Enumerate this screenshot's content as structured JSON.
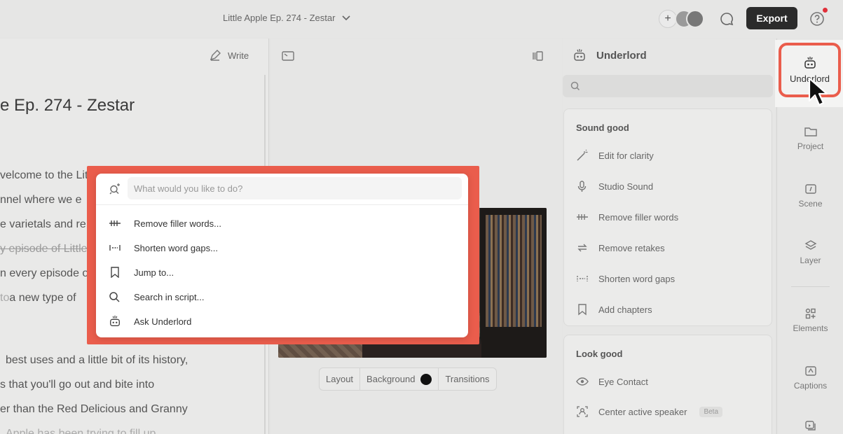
{
  "topbar": {
    "doc_title": "Little Apple Ep. 274 - Zestar",
    "plus_label": "+",
    "export_label": "Export"
  },
  "script": {
    "write_label": "Write",
    "title": "e Ep. 274 - Zestar",
    "paragraphs": [
      "velcome to the Little Apple",
      "nnel where we e",
      "e varietals and re",
      "y episode of Little",
      "n every episode of",
      "to",
      "a new type of",
      "best uses and a little bit of its history,",
      "s that you'll go out and bite into",
      "er than the Red Delicious and Granny",
      "Apple has been trying to fill up"
    ]
  },
  "video_toolbar": {
    "layout": "Layout",
    "background": "Background",
    "transitions": "Transitions"
  },
  "underlord": {
    "title": "Underlord",
    "sections": [
      {
        "title": "Sound good",
        "items": [
          {
            "label": "Edit for clarity",
            "icon": "wand-icon"
          },
          {
            "label": "Studio Sound",
            "icon": "microphone-sparkle-icon"
          },
          {
            "label": "Remove filler words",
            "icon": "filler-words-icon"
          },
          {
            "label": "Remove retakes",
            "icon": "retake-icon"
          },
          {
            "label": "Shorten word gaps",
            "icon": "word-gap-icon"
          },
          {
            "label": "Add chapters",
            "icon": "bookmark-icon"
          }
        ]
      },
      {
        "title": "Look good",
        "items": [
          {
            "label": "Eye Contact",
            "icon": "eye-icon"
          },
          {
            "label": "Center active speaker",
            "icon": "speaker-focus-icon",
            "badge": "Beta"
          }
        ]
      }
    ]
  },
  "rail": {
    "active": "Underlord",
    "items": [
      "Project",
      "Scene",
      "Layer",
      "Elements",
      "Captions"
    ]
  },
  "palette": {
    "placeholder": "What would you like to do?",
    "items": [
      {
        "label": "Remove filler words...",
        "icon": "filler-words-icon"
      },
      {
        "label": "Shorten word gaps...",
        "icon": "word-gap-icon"
      },
      {
        "label": "Jump to...",
        "icon": "bookmark-icon"
      },
      {
        "label": "Search in script...",
        "icon": "search-icon"
      },
      {
        "label": "Ask Underlord",
        "icon": "robot-icon"
      }
    ]
  },
  "colors": {
    "highlight": "#ea5d4c",
    "export_bg": "#2b2b2b",
    "notification": "#e0303a"
  }
}
